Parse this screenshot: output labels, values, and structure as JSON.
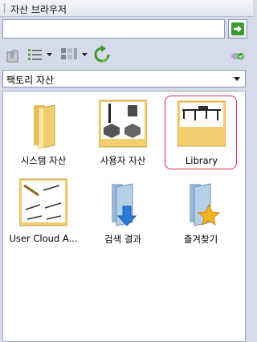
{
  "panel": {
    "title": "자산 브라우저"
  },
  "search": {
    "value": "",
    "go_icon": "go-arrow-icon"
  },
  "toolbar": {
    "up_icon": "folder-up-icon",
    "list_view_icon": "list-view-icon",
    "tile_view_icon": "tile-view-icon",
    "refresh_icon": "refresh-icon",
    "status_icon": "cloud-check-icon"
  },
  "source_select": {
    "value": "팩토리 자산"
  },
  "items": [
    {
      "label": "시스템 자산",
      "icon": "folder-icon"
    },
    {
      "label": "사용자 자산",
      "icon": "folder-shapes-icon"
    },
    {
      "label": "Library",
      "icon": "folder-library-icon",
      "selected": true
    },
    {
      "label": "User Cloud A...",
      "icon": "folder-cloud-icon"
    },
    {
      "label": "검색 결과",
      "icon": "folder-search-results-icon"
    },
    {
      "label": "즐겨찾기",
      "icon": "folder-favorites-icon"
    }
  ],
  "colors": {
    "selection": "#d8333f",
    "folder": "#f2cf6e",
    "go": "#3a9c2c"
  }
}
